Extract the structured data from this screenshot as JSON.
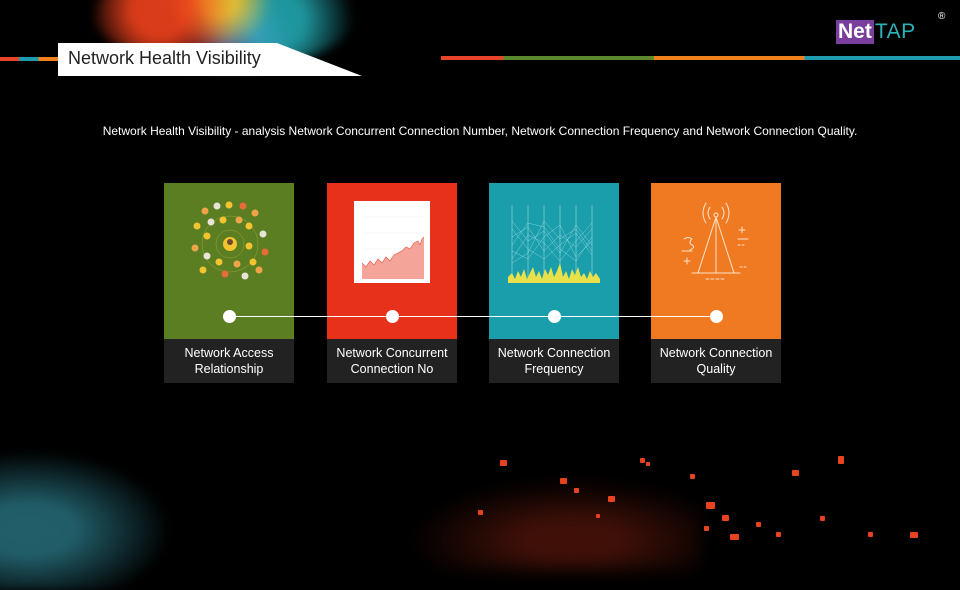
{
  "slide": {
    "title": "Network Health Visibility",
    "description": "Network Health Visibility  - analysis Network Concurrent Connection Number, Network Connection Frequency and Network Connection Quality."
  },
  "logo": {
    "net": "Net",
    "tap": "TAP",
    "registered": "®"
  },
  "colors": {
    "green": "#5a7e21",
    "red": "#e7311b",
    "teal": "#1a9eac",
    "orange": "#f07a21",
    "label_bg": "#222222",
    "logo_purple": "#7a3e9c",
    "logo_teal": "#2bb3b8"
  },
  "cards": [
    {
      "label_line1": "Network Access",
      "label_line2": "Relationship",
      "icon": "people-network-icon"
    },
    {
      "label_line1": "Network Concurrent",
      "label_line2": "Connection No",
      "icon": "area-chart-icon"
    },
    {
      "label_line1": "Network Connection",
      "label_line2": "Frequency",
      "icon": "parallel-lines-icon"
    },
    {
      "label_line1": "Network Connection",
      "label_line2": "Quality",
      "icon": "signal-tower-icon"
    }
  ]
}
